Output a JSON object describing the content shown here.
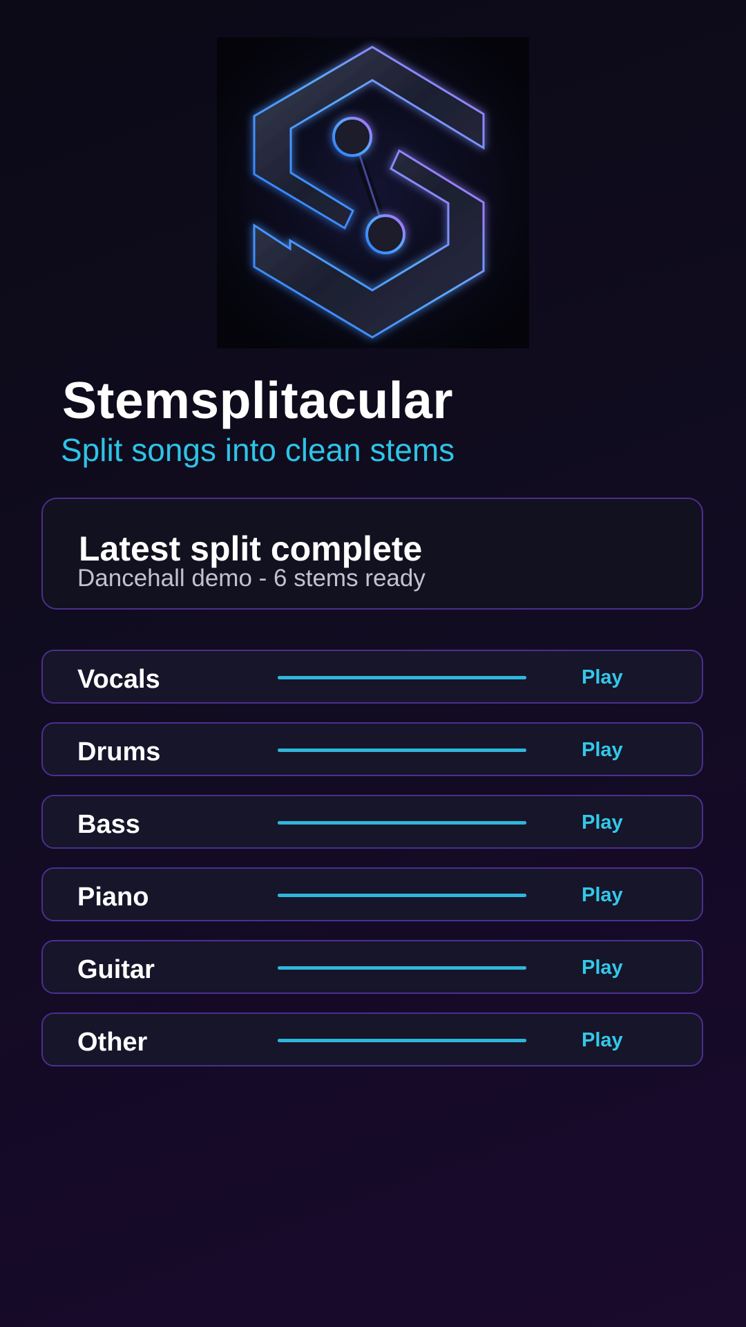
{
  "app": {
    "title": "Stemsplitacular",
    "subtitle": "Split songs into clean stems"
  },
  "logo": {
    "icon": "stemsplitacular-logo-icon"
  },
  "status_card": {
    "title": "Latest split complete",
    "detail": "Dancehall demo - 6 stems ready"
  },
  "stems": [
    {
      "name": "Vocals",
      "play_label": "Play",
      "level": 1.0
    },
    {
      "name": "Drums",
      "play_label": "Play",
      "level": 1.0
    },
    {
      "name": "Bass",
      "play_label": "Play",
      "level": 1.0
    },
    {
      "name": "Piano",
      "play_label": "Play",
      "level": 1.0
    },
    {
      "name": "Guitar",
      "play_label": "Play",
      "level": 1.0
    },
    {
      "name": "Other",
      "play_label": "Play",
      "level": 1.0
    }
  ],
  "colors": {
    "accent": "#2ec4e8",
    "border": "#4b2f8f",
    "card_bg": "#12111f",
    "row_bg": "#171529"
  }
}
